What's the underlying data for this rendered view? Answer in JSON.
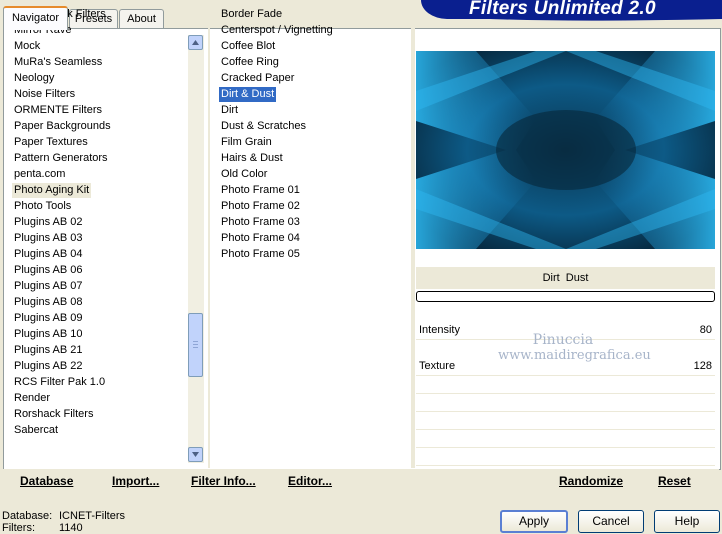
{
  "tabs": [
    {
      "label": "Navigator",
      "active": true
    },
    {
      "label": "Presets",
      "active": false
    },
    {
      "label": "About",
      "active": false
    }
  ],
  "banner": {
    "title": "Filters Unlimited 2.0"
  },
  "categories": {
    "current": "Photo Aging Kit",
    "items": [
      "MediaSpark Filters",
      "Mirror Rave",
      "Mock",
      "MuRa's Seamless",
      "Neology",
      "Noise Filters",
      "ORMENTE Filters",
      "Paper Backgrounds",
      "Paper Textures",
      "Pattern Generators",
      "penta.com",
      "Photo Aging Kit",
      "Photo Tools",
      "Plugins AB 02",
      "Plugins AB 03",
      "Plugins AB 04",
      "Plugins AB 06",
      "Plugins AB 07",
      "Plugins AB 08",
      "Plugins AB 09",
      "Plugins AB 10",
      "Plugins AB 21",
      "Plugins AB 22",
      "RCS Filter Pak 1.0",
      "Render",
      "Rorshack Filters",
      "Sabercat"
    ]
  },
  "filters": {
    "selected": "Dirt & Dust",
    "items": [
      "Border Fade",
      "Centerspot / Vignetting",
      "Coffee Blot",
      "Coffee Ring",
      "Cracked Paper",
      "Dirt & Dust",
      "Dirt",
      "Dust & Scratches",
      "Film Grain",
      "Hairs & Dust",
      "Old Color",
      "Photo Frame 01",
      "Photo Frame 02",
      "Photo Frame 03",
      "Photo Frame 04",
      "Photo Frame 05"
    ]
  },
  "scrollbar": {
    "up_icon": "arrow-up-icon",
    "down_icon": "arrow-down-icon"
  },
  "preview": {
    "filter_name": "Dirt  Dust"
  },
  "params": [
    {
      "label": "Intensity",
      "value": "80"
    },
    {
      "label": "Texture",
      "value": "128"
    }
  ],
  "watermark": {
    "line1": "Pinuccia",
    "line2": "www.maidiregrafica.eu"
  },
  "links": {
    "database": "Database",
    "import": "Import...",
    "filter_info": "Filter Info...",
    "editor": "Editor...",
    "randomize": "Randomize",
    "reset": "Reset"
  },
  "status": {
    "database_label": "Database:",
    "database_value": "ICNET-Filters",
    "filters_label": "Filters:",
    "filters_value": "1140"
  },
  "buttons": {
    "apply": "Apply",
    "cancel": "Cancel",
    "help": "Help"
  },
  "colors": {
    "banner": "#0a1f8f",
    "selection": "#316ac5",
    "preview_blue": "#1ea6e4"
  }
}
